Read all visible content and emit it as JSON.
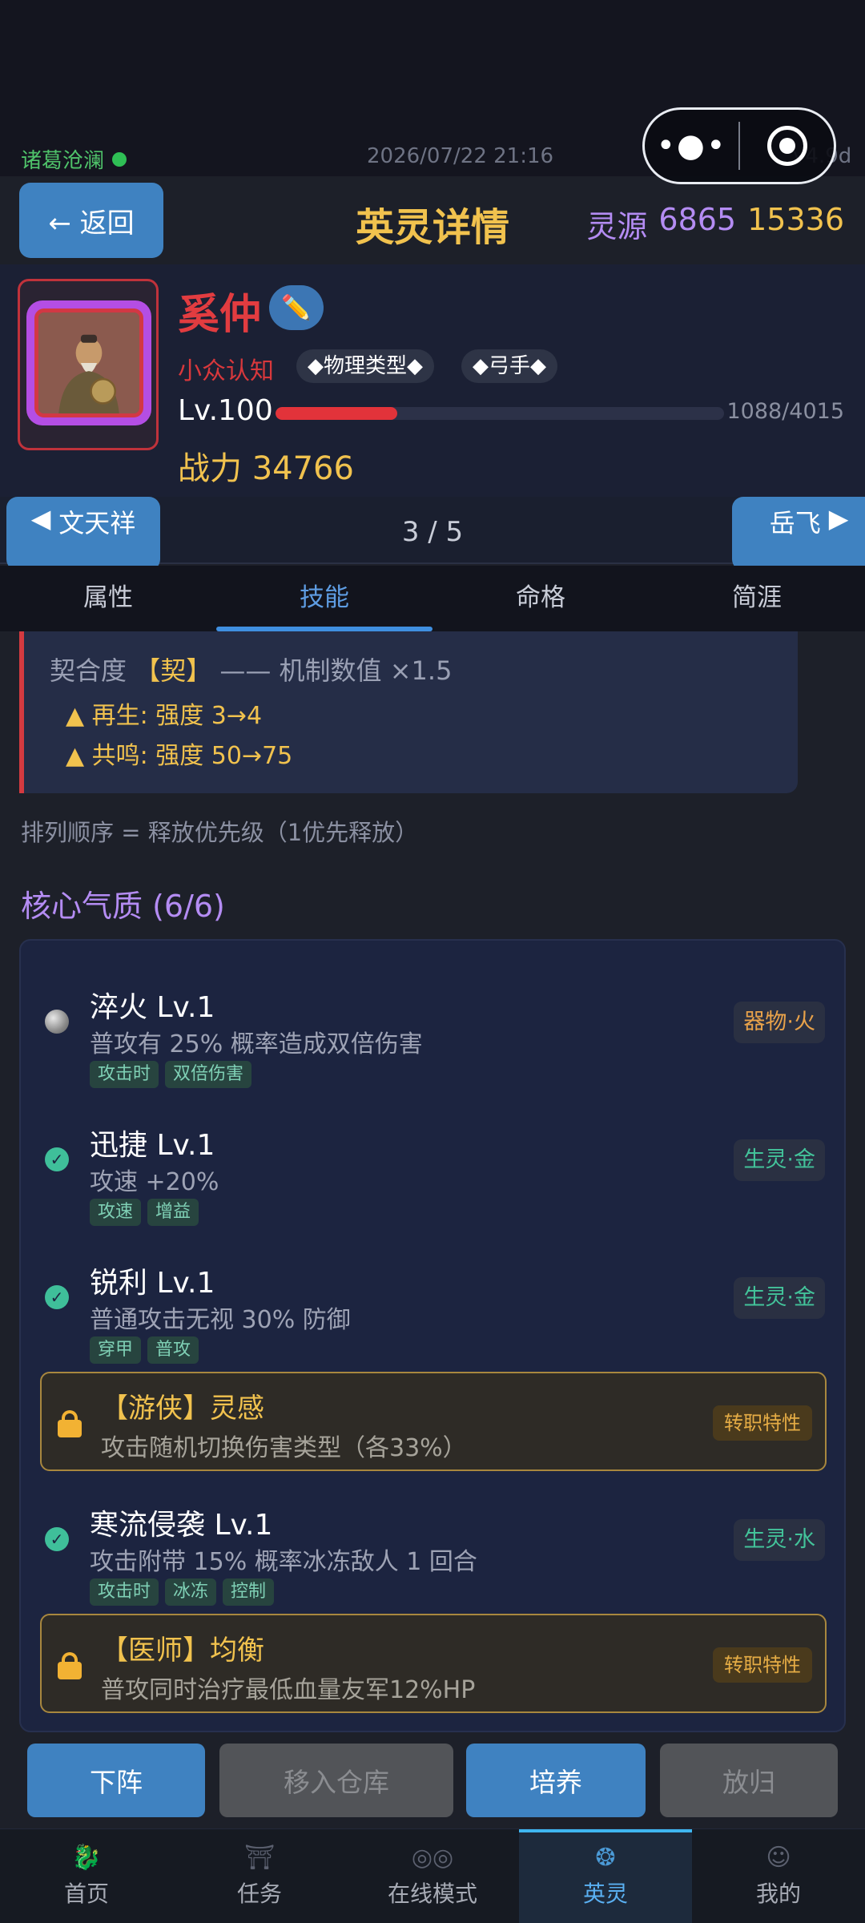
{
  "status": {
    "server": "诸葛沧澜",
    "datetime": "2026/07/22 21:16",
    "version": "v4.9d"
  },
  "header": {
    "back_label": "← 返回",
    "title": "英灵详情",
    "resource_label": "灵源",
    "resource_a": "6865",
    "resource_b": "15336"
  },
  "hero": {
    "name": "奚仲",
    "rarity": "小众认知",
    "tags": [
      "◆物理类型◆",
      "◆弓手◆"
    ],
    "level": "Lv.100",
    "exp_text": "1088/4015",
    "exp_fraction": 0.271,
    "power": "战力 34766"
  },
  "nav": {
    "prev": "文天祥",
    "next": "岳飞",
    "pager": "3 / 5"
  },
  "tabs": [
    "属性",
    "技能",
    "命格",
    "简涯"
  ],
  "affinity": {
    "title": "契合度",
    "mark": "【契】",
    "note": "—— 机制数值 ×1.5",
    "lines": [
      "▲ 再生: 强度 3→4",
      "▲ 共鸣: 强度 50→75"
    ]
  },
  "order_note": "排列顺序 = 释放优先级（1优先释放）",
  "section_title": "核心气质 (6/6)",
  "skills": [
    {
      "name": "淬火 Lv.1",
      "desc": "普攻有 25% 概率造成双倍伤害",
      "tags": [
        "攻击时",
        "双倍伤害"
      ],
      "element": "器物·火"
    },
    {
      "name": "迅捷 Lv.1",
      "desc": "攻速 +20%",
      "tags": [
        "攻速",
        "增益"
      ],
      "element": "生灵·金"
    },
    {
      "name": "锐利 Lv.1",
      "desc": "普通攻击无视 30% 防御",
      "tags": [
        "穿甲",
        "普攻"
      ],
      "element": "生灵·金"
    },
    {
      "name": "寒流侵袭 Lv.1",
      "desc": "攻击附带 15% 概率冰冻敌人 1 回合",
      "tags": [
        "攻击时",
        "冰冻",
        "控制"
      ],
      "element": "生灵·水"
    }
  ],
  "locked_traits": [
    {
      "name": "【游侠】灵感",
      "desc": "攻击随机切换伤害类型（各33%）",
      "badge": "转职特性"
    },
    {
      "name": "【医师】均衡",
      "desc": "普攻同时治疗最低血量友军12%HP",
      "badge": "转职特性"
    }
  ],
  "actions": {
    "deploy": "下阵",
    "storage": "移入仓库",
    "train": "培养",
    "release": "放归"
  },
  "bottom_nav": [
    "首页",
    "任务",
    "在线模式",
    "英灵",
    "我的"
  ],
  "colors": {
    "accent_blue": "#3f82c1",
    "gold": "#f1c24e",
    "purple": "#b48cf3",
    "red": "#e23c40"
  }
}
